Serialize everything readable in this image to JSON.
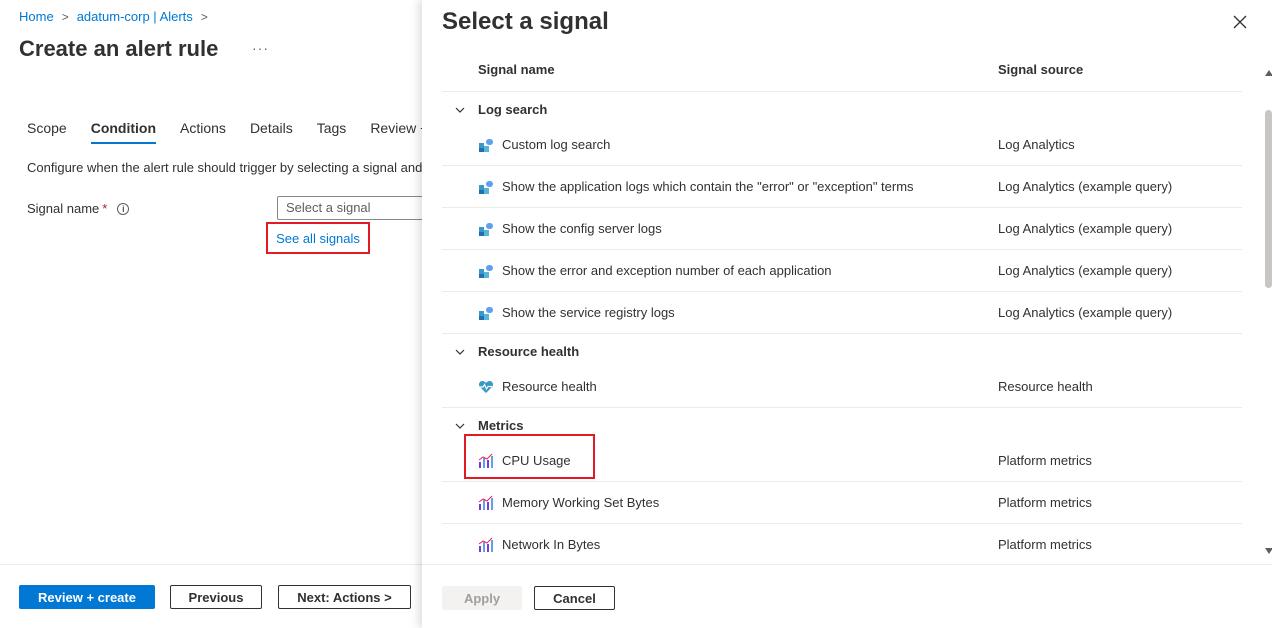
{
  "breadcrumb": {
    "home": "Home",
    "alerts": "adatum-corp | Alerts"
  },
  "page": {
    "title": "Create an alert rule",
    "more": "···"
  },
  "tabs": [
    {
      "label": "Scope"
    },
    {
      "label": "Condition"
    },
    {
      "label": "Actions"
    },
    {
      "label": "Details"
    },
    {
      "label": "Tags"
    },
    {
      "label": "Review +"
    }
  ],
  "condition": {
    "description": "Configure when the alert rule should trigger by selecting a signal and",
    "signal_label": "Signal name",
    "required_mark": "*",
    "info": "i",
    "signal_placeholder": "Select a signal",
    "see_all": "See all signals"
  },
  "footer": {
    "review_create": "Review + create",
    "previous": "Previous",
    "next": "Next: Actions >"
  },
  "panel": {
    "title": "Select a signal",
    "col_name": "Signal name",
    "col_source": "Signal source",
    "apply": "Apply",
    "cancel": "Cancel",
    "groups": [
      {
        "label": "Log search",
        "items": [
          {
            "name": "Custom log search",
            "source": "Log Analytics"
          },
          {
            "name": "Show the application logs which contain the \"error\" or \"exception\" terms",
            "source": "Log Analytics (example query)"
          },
          {
            "name": "Show the config server logs",
            "source": "Log Analytics (example query)"
          },
          {
            "name": "Show the error and exception number of each application",
            "source": "Log Analytics (example query)"
          },
          {
            "name": "Show the service registry logs",
            "source": "Log Analytics (example query)"
          }
        ]
      },
      {
        "label": "Resource health",
        "items": [
          {
            "name": "Resource health",
            "source": "Resource health"
          }
        ]
      },
      {
        "label": "Metrics",
        "items": [
          {
            "name": "CPU Usage",
            "source": "Platform metrics"
          },
          {
            "name": "Memory Working Set Bytes",
            "source": "Platform metrics"
          },
          {
            "name": "Network In Bytes",
            "source": "Platform metrics"
          }
        ]
      }
    ]
  },
  "colors": {
    "accent": "#0078d4",
    "highlight": "#e01b24",
    "text": "#323130"
  }
}
